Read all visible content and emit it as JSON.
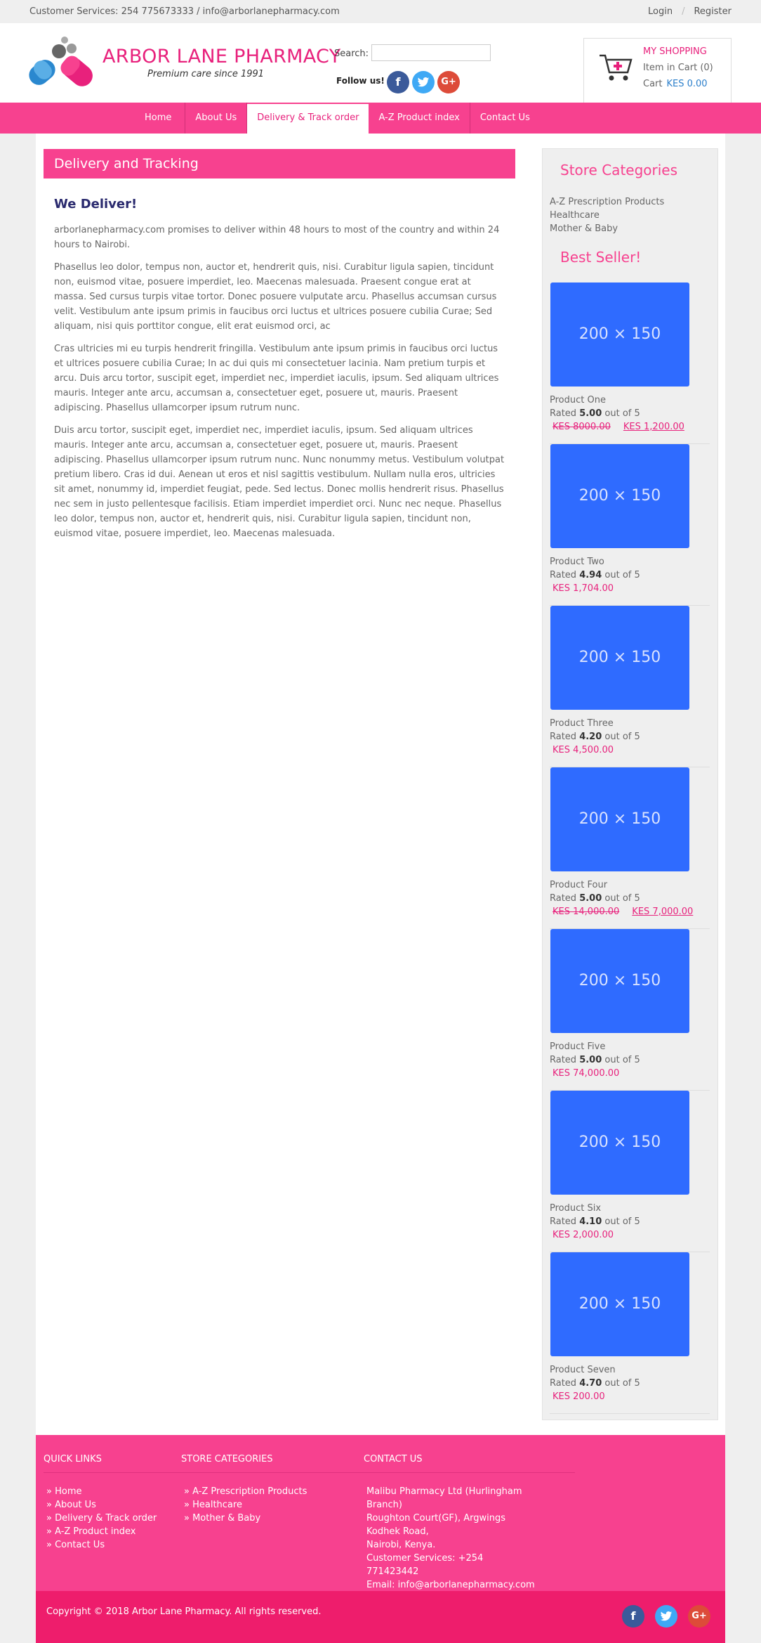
{
  "topbar": {
    "customer_services": "Customer Services: 254 775673333 / info@arborlanepharmacy.com",
    "login": "Login",
    "separator": "/",
    "register": "Register"
  },
  "header": {
    "brand_name": "ARBOR LANE PHARMACY",
    "tagline": "Premium care since 1991",
    "search_label": "Search:",
    "search_value": "",
    "follow_label": "Follow us!",
    "social_icons": [
      "facebook-icon",
      "twitter-icon",
      "google-plus-icon"
    ]
  },
  "cart": {
    "title": "MY SHOPPING",
    "items_label": "Item in Cart (0)",
    "total_label": "Cart",
    "total_value": "KES 0.00"
  },
  "nav": {
    "items": [
      {
        "label": "Home",
        "active": false
      },
      {
        "label": "About Us",
        "active": false
      },
      {
        "label": "Delivery & Track order",
        "active": true
      },
      {
        "label": "A-Z Product index",
        "active": false
      },
      {
        "label": "Contact Us",
        "active": false
      }
    ]
  },
  "content": {
    "header": "Delivery and Tracking",
    "heading": "We Deliver!",
    "paragraphs": [
      "arborlanepharmacy.com promises to deliver within 48 hours to most of the country and within 24 hours to Nairobi.",
      "Phasellus leo dolor, tempus non, auctor et, hendrerit quis, nisi. Curabitur ligula sapien, tincidunt non, euismod vitae, posuere imperdiet, leo. Maecenas malesuada. Praesent congue erat at massa. Sed cursus turpis vitae tortor. Donec posuere vulputate arcu. Phasellus accumsan cursus velit. Vestibulum ante ipsum primis in faucibus orci luctus et ultrices posuere cubilia Curae; Sed aliquam, nisi quis porttitor congue, elit erat euismod orci, ac",
      "Cras ultricies mi eu turpis hendrerit fringilla. Vestibulum ante ipsum primis in faucibus orci luctus et ultrices posuere cubilia Curae; In ac dui quis mi consectetuer lacinia. Nam pretium turpis et arcu. Duis arcu tortor, suscipit eget, imperdiet nec, imperdiet iaculis, ipsum. Sed aliquam ultrices mauris. Integer ante arcu, accumsan a, consectetuer eget, posuere ut, mauris. Praesent adipiscing. Phasellus ullamcorper ipsum rutrum nunc.",
      "Duis arcu tortor, suscipit eget, imperdiet nec, imperdiet iaculis, ipsum. Sed aliquam ultrices mauris. Integer ante arcu, accumsan a, consectetuer eget, posuere ut, mauris. Praesent adipiscing. Phasellus ullamcorper ipsum rutrum nunc. Nunc nonummy metus. Vestibulum volutpat pretium libero. Cras id dui. Aenean ut eros et nisl sagittis vestibulum. Nullam nulla eros, ultricies sit amet, nonummy id, imperdiet feugiat, pede. Sed lectus. Donec mollis hendrerit risus. Phasellus nec sem in justo pellentesque facilisis. Etiam imperdiet imperdiet orci. Nunc nec neque. Phasellus leo dolor, tempus non, auctor et, hendrerit quis, nisi. Curabitur ligula sapien, tincidunt non, euismod vitae, posuere imperdiet, leo. Maecenas malesuada."
    ]
  },
  "sidebar": {
    "categories_title": "Store Categories",
    "categories": [
      "A-Z Prescription Products",
      "Healthcare",
      "Mother & Baby"
    ],
    "best_seller_title": "Best Seller!",
    "placeholder_text": "200 × 150",
    "products": [
      {
        "name": "Product One",
        "rated": "Rated",
        "rating": "5.00",
        "out_of": "out of 5",
        "old_price": "KES 8000.00",
        "price": "KES 1,200.00"
      },
      {
        "name": "Product Two",
        "rated": "Rated",
        "rating": "4.94",
        "out_of": "out of 5",
        "old_price": "",
        "price": "KES 1,704.00"
      },
      {
        "name": "Product Three",
        "rated": "Rated",
        "rating": "4.20",
        "out_of": "out of 5",
        "old_price": "",
        "price": "KES 4,500.00"
      },
      {
        "name": "Product Four",
        "rated": "Rated",
        "rating": "5.00",
        "out_of": "out of 5",
        "old_price": "KES 14,000.00",
        "price": "KES 7,000.00"
      },
      {
        "name": "Product Five",
        "rated": "Rated",
        "rating": "5.00",
        "out_of": "out of 5",
        "old_price": "",
        "price": "KES 74,000.00"
      },
      {
        "name": "Product Six",
        "rated": "Rated",
        "rating": "4.10",
        "out_of": "out of 5",
        "old_price": "",
        "price": "KES 2,000.00"
      },
      {
        "name": "Product Seven",
        "rated": "Rated",
        "rating": "4.70",
        "out_of": "out of 5",
        "old_price": "",
        "price": "KES 200.00"
      }
    ]
  },
  "footer": {
    "quick_links_title": "QUICK LINKS",
    "quick_links": [
      "Home",
      "About Us",
      "Delivery & Track order",
      "A-Z Product index",
      "Contact Us"
    ],
    "store_categories_title": "STORE CATEGORIES",
    "store_categories": [
      "A-Z Prescription Products",
      "Healthcare",
      "Mother & Baby"
    ],
    "contact_title": "CONTACT US",
    "contact_lines": [
      "Malibu Pharmacy Ltd (Hurlingham Branch)",
      "Roughton Court(GF), Argwings Kodhek Road,",
      "Nairobi, Kenya.",
      "Customer Services: +254 771423442",
      "Email: info@arborlanepharmacy.com"
    ],
    "copyright": "Copyright © 2018 Arbor Lane Pharmacy. All rights reserved."
  },
  "colors": {
    "brand_pink": "#f7418f",
    "dark_pink": "#ee1d6c",
    "link_blue": "#2b7fcb",
    "placeholder_blue": "#2f6bff"
  }
}
